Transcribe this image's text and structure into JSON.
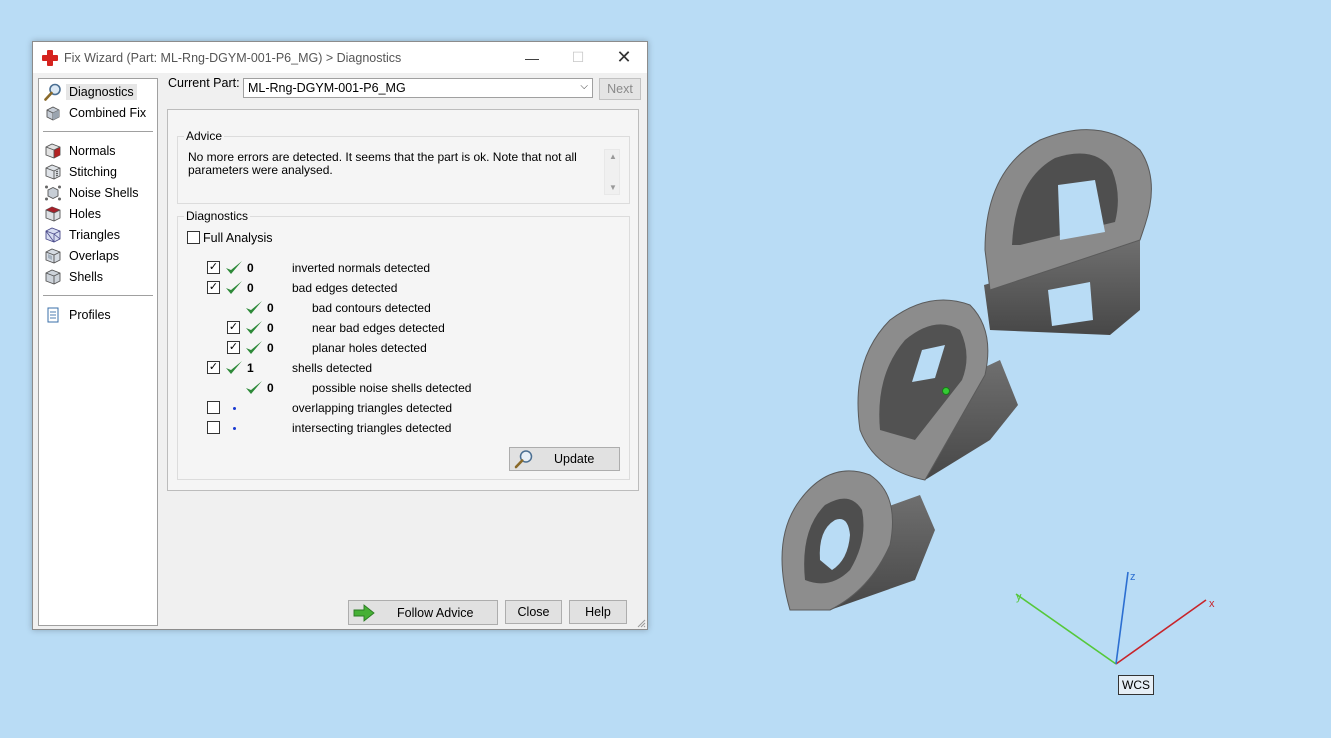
{
  "window": {
    "title": "Fix Wizard (Part: ML-Rng-DGYM-001-P6_MG) > Diagnostics",
    "minimize_glyph": "—",
    "maximize_glyph": "☐",
    "close_glyph": "✕"
  },
  "nav": {
    "top_items": [
      {
        "label": "Diagnostics",
        "icon": "magnifier-icon",
        "selected": true
      },
      {
        "label": "Combined Fix",
        "icon": "combined-fix-icon"
      }
    ],
    "fix_items": [
      {
        "label": "Normals",
        "icon": "normals-icon"
      },
      {
        "label": "Stitching",
        "icon": "stitching-icon"
      },
      {
        "label": "Noise Shells",
        "icon": "noise-shells-icon"
      },
      {
        "label": "Holes",
        "icon": "holes-icon"
      },
      {
        "label": "Triangles",
        "icon": "triangles-icon"
      },
      {
        "label": "Overlaps",
        "icon": "overlaps-icon"
      },
      {
        "label": "Shells",
        "icon": "shells-icon"
      }
    ],
    "bottom_items": [
      {
        "label": "Profiles",
        "icon": "profiles-icon"
      }
    ]
  },
  "current_part": {
    "label": "Current Part:",
    "value": "ML-Rng-DGYM-001-P6_MG",
    "next_label": "Next"
  },
  "advice": {
    "title": "Advice",
    "text": "No more errors are detected. It seems that the part is ok. Note that not all parameters were analysed."
  },
  "diagnostics": {
    "title": "Diagnostics",
    "full_analysis_label": "Full Analysis",
    "full_analysis_checked": false,
    "rows": [
      {
        "checkbox": true,
        "checked": true,
        "status": "ok",
        "count": "0",
        "label": "inverted normals detected",
        "indent": 0
      },
      {
        "checkbox": true,
        "checked": true,
        "status": "ok",
        "count": "0",
        "label": "bad edges detected",
        "indent": 0
      },
      {
        "checkbox": false,
        "checked": false,
        "status": "ok",
        "count": "0",
        "label": "bad contours detected",
        "indent": 1
      },
      {
        "checkbox": true,
        "checked": true,
        "status": "ok",
        "count": "0",
        "label": "near bad edges detected",
        "indent": 1
      },
      {
        "checkbox": true,
        "checked": true,
        "status": "ok",
        "count": "0",
        "label": "planar holes detected",
        "indent": 1
      },
      {
        "checkbox": true,
        "checked": true,
        "status": "ok",
        "count": "1",
        "label": "shells detected",
        "indent": 0
      },
      {
        "checkbox": false,
        "checked": false,
        "status": "ok",
        "count": "0",
        "label": "possible noise shells detected",
        "indent": 1
      },
      {
        "checkbox": true,
        "checked": false,
        "status": "none",
        "count": "",
        "label": "overlapping triangles detected",
        "indent": 0
      },
      {
        "checkbox": true,
        "checked": false,
        "status": "none",
        "count": "",
        "label": "intersecting triangles detected",
        "indent": 0
      }
    ],
    "update_label": "Update"
  },
  "footer": {
    "follow_advice_label": "Follow Advice",
    "close_label": "Close",
    "help_label": "Help"
  },
  "viewport": {
    "axes": {
      "x": "x",
      "y": "y",
      "z": "z"
    },
    "wcs_label": "WCS",
    "colors": {
      "x_axis": "#c8242a",
      "y_axis": "#55c83a",
      "z_axis": "#2c6fd1",
      "model": "#7d7d7d"
    }
  }
}
